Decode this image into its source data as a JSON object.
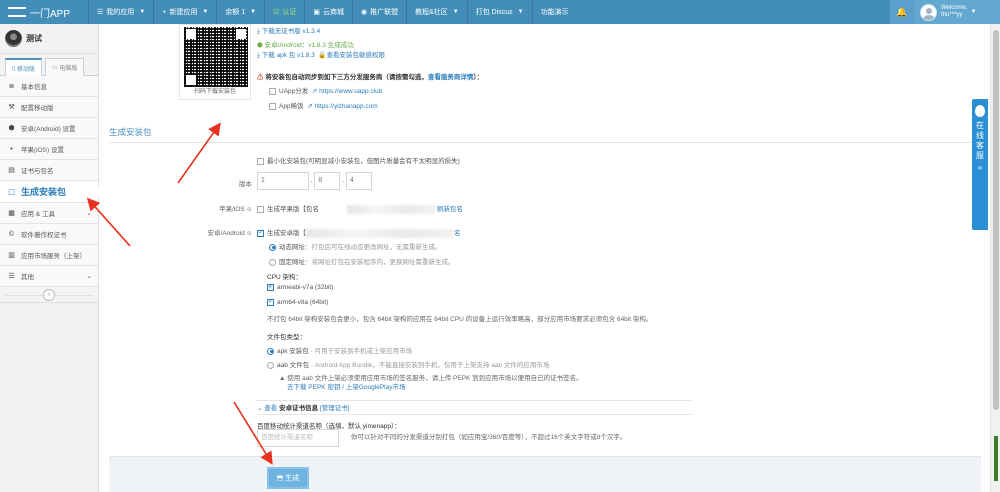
{
  "header": {
    "logo": "一门APP",
    "nav": [
      {
        "icon": "menu-icon",
        "label": "我的应用",
        "dropdown": true
      },
      {
        "icon": "plus-icon",
        "label": "新建应用",
        "dropdown": true
      },
      {
        "icon": "",
        "label": "余额 1",
        "dropdown": true
      },
      {
        "icon": "checkbox-icon",
        "label": "认证",
        "green": true
      },
      {
        "icon": "calendar-icon",
        "label": "云商城"
      },
      {
        "icon": "globe-icon",
        "label": "推广联盟"
      },
      {
        "icon": "",
        "label": "教程&社区",
        "dropdown": true
      },
      {
        "icon": "",
        "label": "打包 Discuz",
        "dropdown": true
      },
      {
        "icon": "",
        "label": "功能演示"
      }
    ],
    "welcome": "Welcome,",
    "username": "thu***yy"
  },
  "sidebar": {
    "app_name": "测试",
    "tabs": [
      {
        "label": "移动版",
        "active": true
      },
      {
        "label": "电脑版",
        "active": false
      }
    ],
    "items": [
      {
        "icon": "list-icon",
        "label": "基本信息"
      },
      {
        "icon": "tools-icon",
        "label": "配置移动版"
      },
      {
        "icon": "android-icon",
        "label": "安卓(Android) 设置"
      },
      {
        "icon": "apple-icon",
        "label": "苹果(iOS) 设置"
      },
      {
        "icon": "certificate-icon",
        "label": "证书与包名"
      },
      {
        "icon": "build-icon",
        "label": "生成安装包",
        "active": true
      },
      {
        "icon": "grid-icon",
        "label": "应用 & 工具",
        "expandable": true
      },
      {
        "icon": "copyright-icon",
        "label": "软件著作权证书"
      },
      {
        "icon": "store-icon",
        "label": "应用市场服务（上架）"
      },
      {
        "icon": "menu-icon",
        "label": "其他",
        "expandable": true
      }
    ]
  },
  "top": {
    "qr_caption": "扫码下载安装包",
    "download_old": "下载无证书版 v1.3.4",
    "android_status": "安卓/Android：v1.8.3 生成成功",
    "download_apk": "下载 apk 包 v1.8.3",
    "view_perm": "查看安装包敏感权限",
    "sync_note": "将安装包自动同步到如下三方分发服务商（请按需勾选，",
    "sync_link": "查看服务商详情",
    "sync_end": "）：",
    "vendors": [
      {
        "name": "UApp分发",
        "url": "https://www.uapp.club"
      },
      {
        "name": "App稀饭",
        "url": "https://yizhanapp.com"
      }
    ]
  },
  "form": {
    "section_title": "生成安装包",
    "minimize_label": "最小化安装包(可明显减小安装包，但图片质量会有不太明显的损失)",
    "version_label": "版本",
    "version": [
      "1",
      "8",
      "4"
    ],
    "ios_label": "苹果/iOS",
    "ios_text": "生成苹果版【包名",
    "ios_edit": "刷新包名",
    "android_label": "安卓/Android",
    "android_text": "生成安卓版【",
    "android_tail": "名",
    "url_options": [
      {
        "label": "动态网址",
        "desc": "：打包后可在线动态更改网址，无需重新生成。",
        "checked": true
      },
      {
        "label": "固定网址",
        "desc": "：将网址打包在安装程序内，更换网址需重新生成。",
        "checked": false
      }
    ],
    "cpu_label": "CPU 架构：",
    "cpu": [
      {
        "label": "armeabi-v7a (32bit)",
        "checked": true,
        "disabled": true
      },
      {
        "label": "arm64-v8a (64bit)",
        "checked": true,
        "disabled": false
      }
    ],
    "cpu_note": "不打包 64bit 架构安装包会更小，包含 64bit 架构的应用在 64bit CPU 的设备上运行效率略高，部分应用市场要求必须包含 64bit 架构。",
    "pkg_type_label": "文件包类型：",
    "pkg_types": [
      {
        "label": "apk 安装包",
        "desc": " - 可用于安装到手机或上架应用市场",
        "checked": true
      },
      {
        "label": "aab 文件包",
        "desc": " - Android App Bundle，不能直接安装到手机，仅用于上架支持 aab 文件的应用市场",
        "checked": false
      }
    ],
    "aab_warning": "使用 aab 文件上架必须使用应用市场的签名服务，请上传 PEPK 到到应用市场以便用自己的证书签名。",
    "aab_links": "去下载 PEPK 密钥 / 上架GooglePlay市场",
    "cert_toggle": "查看",
    "cert_info": "安卓证书信息",
    "cert_manage": "[管理证书]",
    "channel_label": "百度移动统计渠道名称（选填，默认 yimenapp）：",
    "channel_placeholder": "百度统计渠道名称",
    "channel_hint": "你可以针对不同的分发渠道分别打包（如应用宝/360/百度等），不超过16个英文字符或8个汉字。",
    "generate_button": "生成"
  },
  "online_service": {
    "label": "在线客服",
    "chevron": "«"
  }
}
